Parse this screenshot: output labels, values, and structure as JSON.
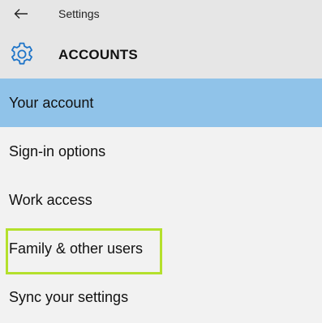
{
  "window": {
    "title": "Settings",
    "back_icon": "back-arrow-icon"
  },
  "header": {
    "icon": "gear-icon",
    "title": "ACCOUNTS",
    "accent_color": "#1e74c8"
  },
  "nav": {
    "selected_color": "#90c3e9",
    "highlight_color": "#b4e02c",
    "items": [
      {
        "label": "Your account",
        "selected": true
      },
      {
        "label": "Sign-in options",
        "selected": false
      },
      {
        "label": "Work access",
        "selected": false
      },
      {
        "label": "Family & other users",
        "selected": false,
        "highlighted": true
      },
      {
        "label": "Sync your settings",
        "selected": false
      }
    ]
  }
}
